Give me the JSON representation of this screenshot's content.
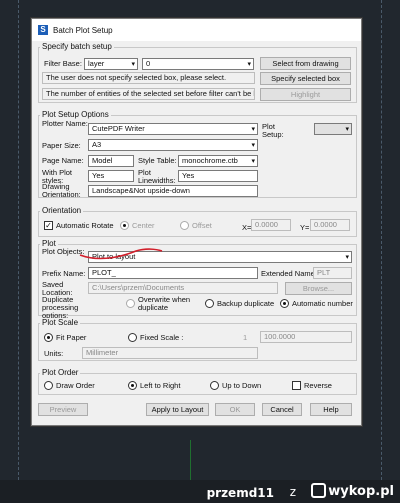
{
  "footer": {
    "username": "przemd11",
    "z": "z",
    "logo": "wykop.pl"
  },
  "window": {
    "title": "Batch Plot Setup"
  },
  "batch": {
    "group_label": "Specify batch setup",
    "filter_base_label": "Filter Base:",
    "filter_base_value": "layer",
    "filter_value": "0",
    "select_from_drawing": "Select from drawing",
    "msg1": "The user does not specify selected box, please select.",
    "specify_selected_box": "Specify selected box",
    "msg2": "The number of entities of the selected set before filter can't be less than 1",
    "highlight": "Highlight"
  },
  "options": {
    "group_label": "Plot Setup  Options",
    "plotter_name_label": "Plotter Name:",
    "plotter_name": "CutePDF Writer",
    "plot_setup_label": "Plot Setup:",
    "plot_setup_value": "",
    "paper_size_label": "Paper Size:",
    "paper_size": "A3",
    "page_name_label": "Page Name:",
    "page_name": "Model",
    "style_table_label": "Style Table:",
    "style_table": "monochrome.ctb",
    "with_plot_styles_label": "With Plot styles:",
    "with_plot_styles": "Yes",
    "plot_lineweights_label": "Plot Linewidths:",
    "plot_lineweights": "Yes",
    "drawing_orientation_label": "Drawing Orientation:",
    "drawing_orientation": "Landscape&Not upside-down"
  },
  "orientation": {
    "group_label": "Orientation",
    "automatic_rotate": "Automatic Rotate",
    "center": "Center",
    "offset": "Offset",
    "x_label": "X=",
    "x_value": "0.0000",
    "y_label": "Y=",
    "y_value": "0.0000"
  },
  "plot": {
    "group_label": "Plot",
    "plot_objects_label": "Plot Objects:",
    "plot_objects": "Plot to layout",
    "prefix_name_label": "Prefix Name:",
    "prefix_name": "PLOT_",
    "extended_name_label": "Extended Name:",
    "extended_name": "PLT",
    "saved_location_label": "Saved Location:",
    "saved_location": "C:\\Users\\przem\\Documents",
    "browse": "Browse...",
    "duplicate_label": "Duplicate processing options:",
    "overwrite": "Overwrite when duplicate",
    "backup_duplicate": "Backup duplicate",
    "automatic_number": "Automatic number"
  },
  "scale": {
    "group_label": "Plot Scale",
    "fit_paper": "Fit Paper",
    "fixed_scale": "Fixed Scale :",
    "scale_left": "1",
    "scale_right": "100.0000",
    "units_label": "Units:",
    "units": "Millimeter"
  },
  "order": {
    "group_label": "Plot Order",
    "draw_order": "Draw Order",
    "left_to_right": "Left to Right",
    "up_to_down": "Up to Down",
    "reverse": "Reverse"
  },
  "buttons": {
    "preview": "Preview",
    "apply_to_layout": "Apply to Layout",
    "ok": "OK",
    "cancel": "Cancel",
    "help": "Help"
  }
}
